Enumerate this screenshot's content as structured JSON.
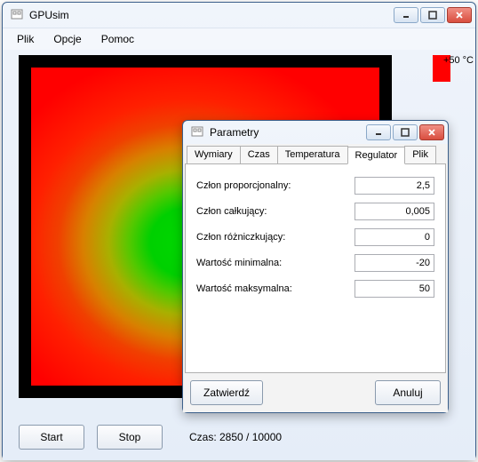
{
  "main_window": {
    "title": "GPUsim",
    "menu": {
      "file": "Plik",
      "options": "Opcje",
      "help": "Pomoc"
    },
    "scale_max_label": "+50 °C",
    "buttons": {
      "start": "Start",
      "stop": "Stop"
    },
    "frame_label": "Czas: 2850 / 10000"
  },
  "dialog": {
    "title": "Parametry",
    "tabs": {
      "wymiary": "Wymiary",
      "czas": "Czas",
      "temperatura": "Temperatura",
      "regulator": "Regulator",
      "plik": "Plik"
    },
    "active_tab": "regulator",
    "regulator": {
      "labels": {
        "kp": "Człon proporcjonalny:",
        "ki": "Człon całkujący:",
        "kd": "Człon różniczkujący:",
        "min": "Wartość minimalna:",
        "max": "Wartość maksymalna:"
      },
      "values": {
        "kp": "2,5",
        "ki": "0,005",
        "kd": "0",
        "min": "-20",
        "max": "50"
      }
    },
    "buttons": {
      "ok": "Zatwierdź",
      "cancel": "Anuluj"
    }
  }
}
